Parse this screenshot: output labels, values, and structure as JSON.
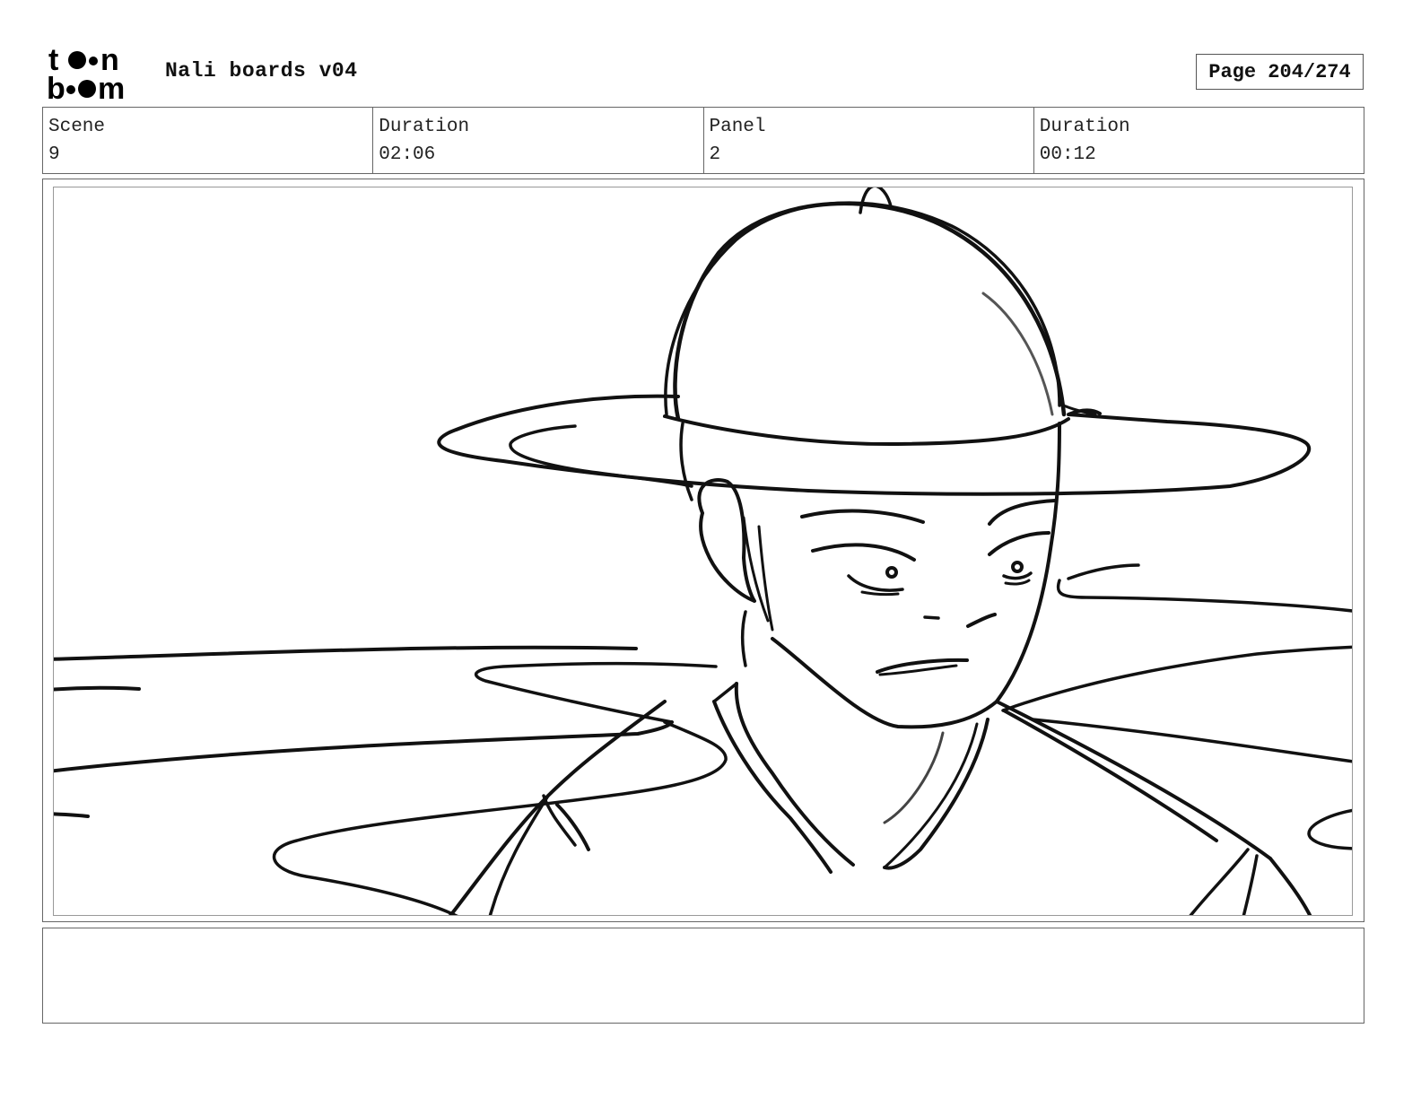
{
  "header": {
    "logo": "toon boom",
    "title": "Nali boards v04",
    "page": "Page 204/274"
  },
  "info": {
    "scene_label": "Scene",
    "scene_value": "9",
    "scene_duration_label": "Duration",
    "scene_duration_value": "02:06",
    "panel_label": "Panel",
    "panel_value": "2",
    "panel_duration_label": "Duration",
    "panel_duration_value": "00:12"
  },
  "notes": {
    "text": ""
  }
}
